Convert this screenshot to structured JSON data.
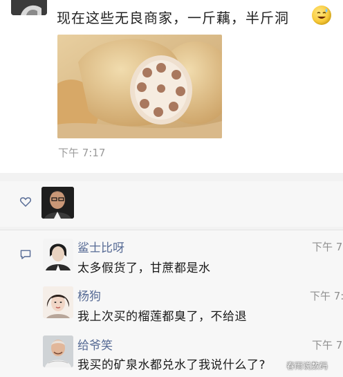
{
  "post": {
    "text": "现在这些无良商家，一斤藕，半斤洞",
    "emoji": "grinning-sweat-emoji",
    "time": "下午 7:17"
  },
  "likes": {
    "icon": "heart-icon"
  },
  "comments": [
    {
      "name": "鲨士比呀",
      "text": "太多假货了，甘蔗都是水",
      "time": "下午 7:"
    },
    {
      "name": "杨狗",
      "text": "我上次买的榴莲都臭了，不给退",
      "time": "下午 7:"
    },
    {
      "name": "给爷笑",
      "text": "我买的矿泉水都兑水了我说什么了?",
      "time": "下午 7:"
    }
  ],
  "watermark": "春雨说数码",
  "colors": {
    "name_blue": "#576b95",
    "time_gray": "#9a9a9a"
  }
}
